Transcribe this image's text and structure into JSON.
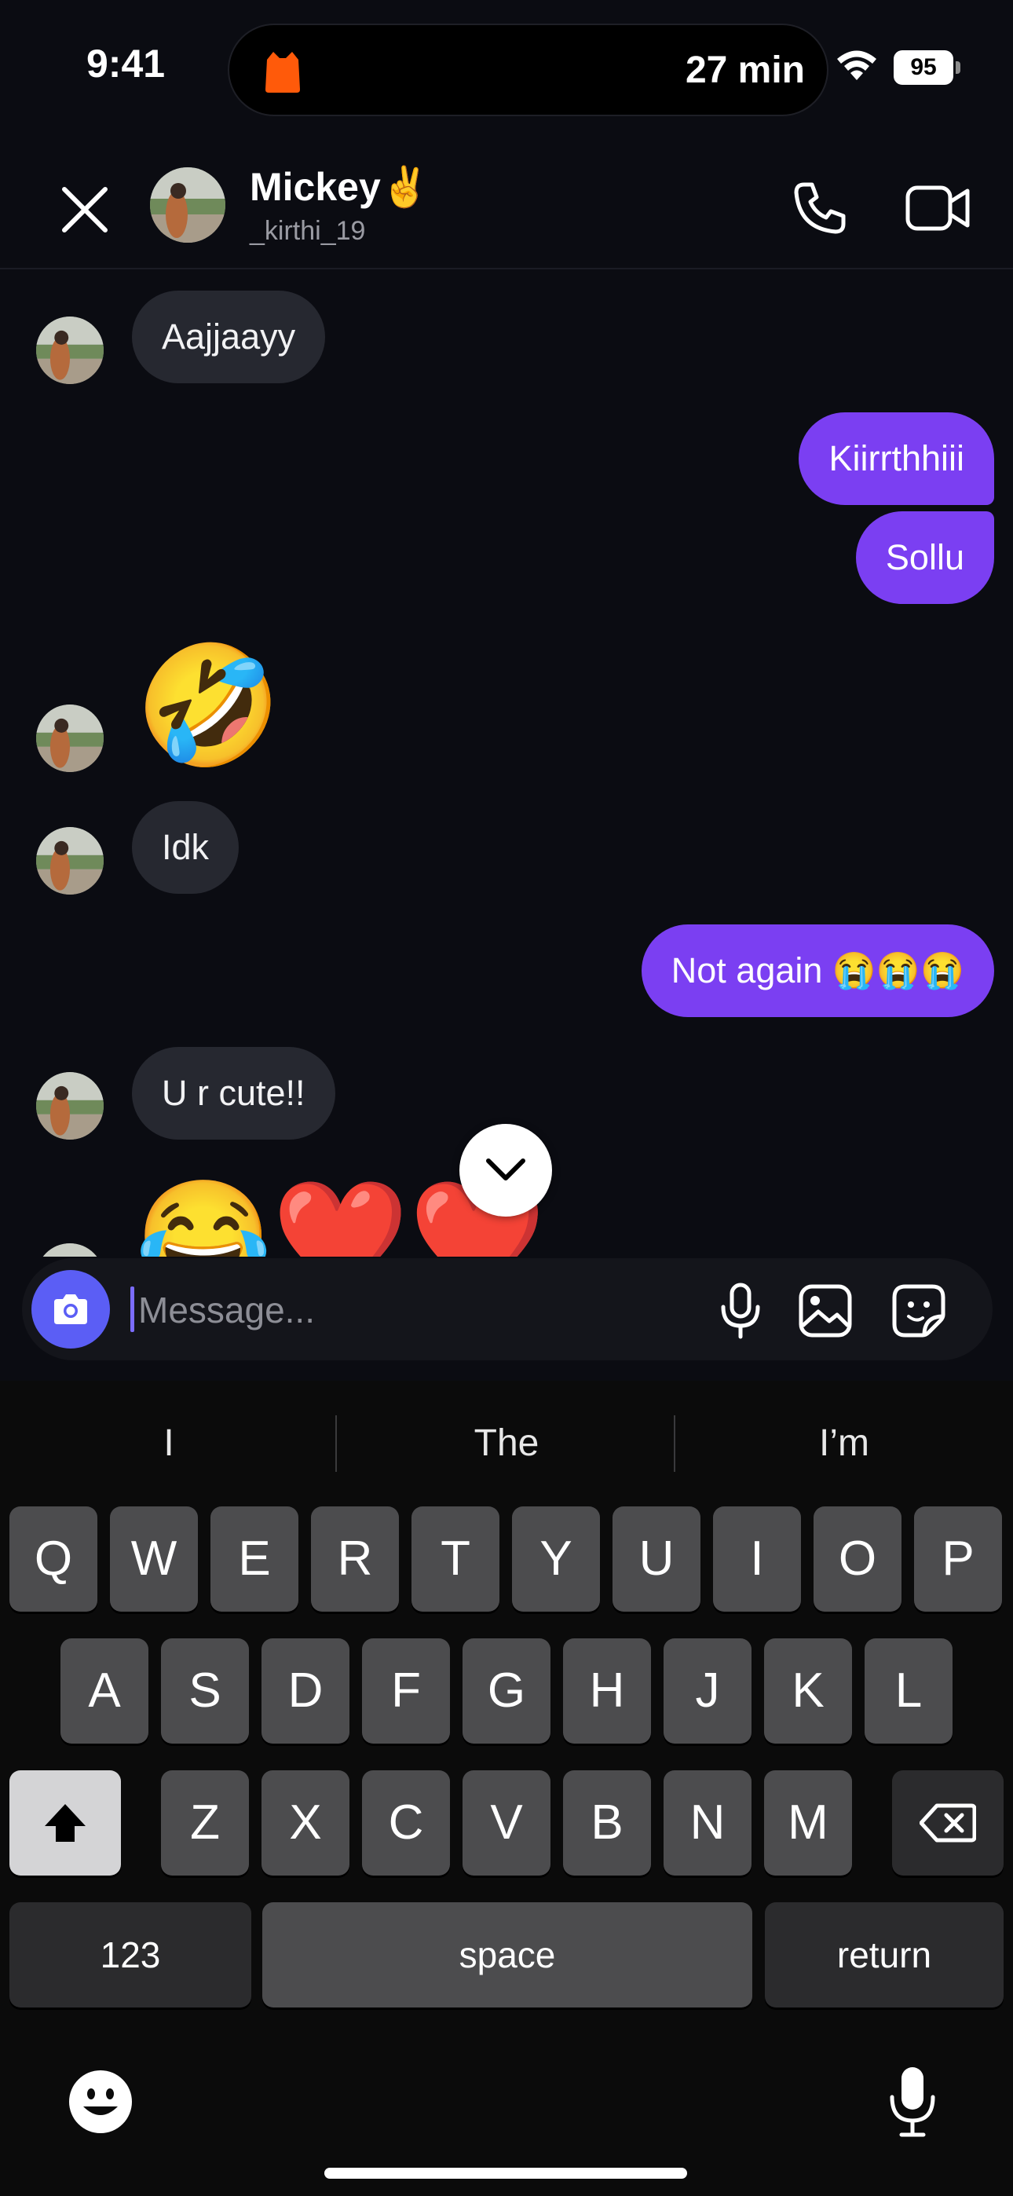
{
  "status_bar": {
    "time": "9:41",
    "activity_text": "27 min",
    "battery": "95"
  },
  "chat_header": {
    "contact_name": "Mickey✌️",
    "username": "_kirthi_19"
  },
  "messages": [
    {
      "from": "them",
      "text": "Aajjaayy"
    },
    {
      "from": "me",
      "text": "Kiirrthhiii"
    },
    {
      "from": "me",
      "text": "Sollu"
    },
    {
      "from": "them",
      "text": "🤣",
      "emoji_only": true
    },
    {
      "from": "them",
      "text": "Idk"
    },
    {
      "from": "me",
      "text": "Not again 😭😭😭"
    },
    {
      "from": "them",
      "text": "U r cute!!"
    },
    {
      "from": "them",
      "text": "😂❤️❤️",
      "emoji_only": true
    }
  ],
  "composer": {
    "placeholder": "Message..."
  },
  "keyboard": {
    "suggestions": [
      "I",
      "The",
      "I’m"
    ],
    "row1": [
      "Q",
      "W",
      "E",
      "R",
      "T",
      "Y",
      "U",
      "I",
      "O",
      "P"
    ],
    "row2": [
      "A",
      "S",
      "D",
      "F",
      "G",
      "H",
      "J",
      "K",
      "L"
    ],
    "row3": [
      "Z",
      "X",
      "C",
      "V",
      "B",
      "N",
      "M"
    ],
    "numbers_key": "123",
    "space_key": "space",
    "return_key": "return"
  },
  "colors": {
    "background": "#0b0c12",
    "outgoing_bubble": "#7b3ff2",
    "incoming_bubble": "#262830",
    "camera_button": "#5b5ef5",
    "key": "#4c4c4e"
  },
  "icons": [
    "close-icon",
    "phone-icon",
    "video-camera-icon",
    "camera-icon",
    "microphone-icon",
    "gallery-icon",
    "sticker-icon",
    "chevron-down-icon",
    "shift-icon",
    "backspace-icon",
    "emoji-icon",
    "dictation-icon",
    "wifi-icon"
  ]
}
